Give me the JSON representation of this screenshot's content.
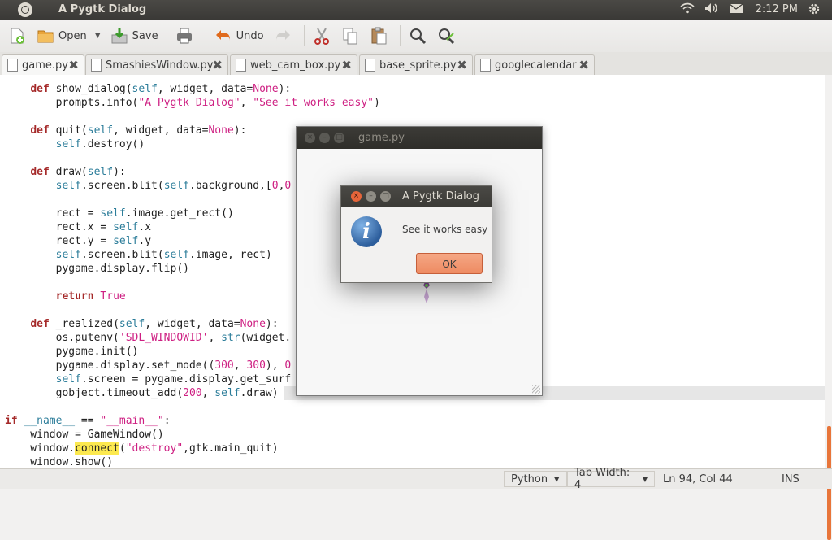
{
  "window": {
    "title": "A Pygtk Dialog"
  },
  "tray": {
    "clock": "2:12 PM"
  },
  "toolbar": {
    "open_label": "Open",
    "save_label": "Save",
    "undo_label": "Undo"
  },
  "tabs": [
    {
      "label": "game.py"
    },
    {
      "label": "SmashiesWindow.py"
    },
    {
      "label": "web_cam_box.py"
    },
    {
      "label": "base_sprite.py"
    },
    {
      "label": "googlecalendar"
    }
  ],
  "code_lines": [
    "    def show_dialog(self, widget, data=None):",
    "        prompts.info(\"A Pygtk Dialog\", \"See it works easy\")",
    "",
    "    def quit(self, widget, data=None):",
    "        self.destroy()",
    "",
    "    def draw(self):",
    "        self.screen.blit(self.background,[0,0",
    "",
    "        rect = self.image.get_rect()",
    "        rect.x = self.x",
    "        rect.y = self.y",
    "        self.screen.blit(self.image, rect)",
    "        pygame.display.flip()",
    "",
    "        return True",
    "",
    "    def _realized(self, widget, data=None):",
    "        os.putenv('SDL_WINDOWID', str(widget.",
    "        pygame.init()",
    "        pygame.display.set_mode((300, 300), 0",
    "        self.screen = pygame.display.get_surf",
    "        gobject.timeout_add(200, self.draw)",
    "",
    "if __name__ == \"__main__\":",
    "    window = GameWindow()",
    "    window.connect(\"destroy\",gtk.main_quit)",
    "    window.show()"
  ],
  "game_window": {
    "title": "game.py"
  },
  "dialog": {
    "title": "A Pygtk Dialog",
    "message": "See it works easy",
    "ok_label": "OK"
  },
  "statusbar": {
    "language": "Python",
    "tab_width": "Tab Width:  4",
    "position": "Ln 94, Col 44",
    "mode": "INS"
  }
}
